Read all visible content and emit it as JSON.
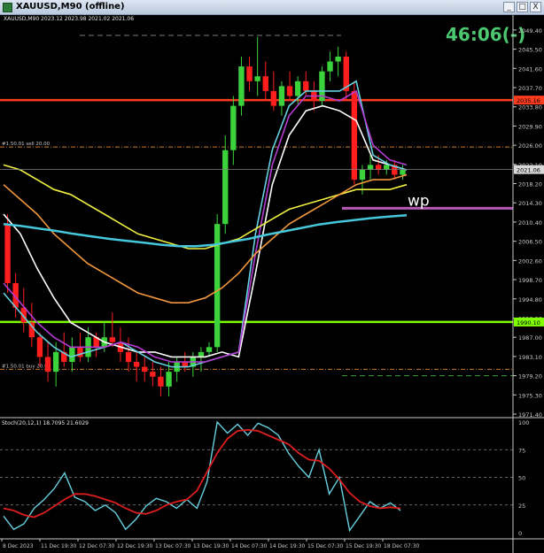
{
  "window": {
    "title": "XAUUSD,M90 (offline)",
    "buttons": [
      "_",
      "□",
      "X"
    ]
  },
  "chart_data": [
    {
      "type": "candlestick",
      "header": "XAUUSD,M90  2023.12 2023.98 2021.02 2021.06",
      "countdown": "46:06(-)",
      "ylim": [
        1971.4,
        2051.0
      ],
      "y_ticks": [
        "2049.40",
        "2045.50",
        "2041.60",
        "2037.70",
        "2033.80",
        "2029.90",
        "2026.00",
        "2022.10",
        "2018.20",
        "2014.30",
        "2010.40",
        "2006.50",
        "2002.60",
        "1998.70",
        "1994.80",
        "1990.90",
        "1987.00",
        "1983.10",
        "1979.20",
        "1975.30",
        "1971.40"
      ],
      "current_price": "2021.06",
      "hlines": [
        {
          "price": 2035.16,
          "label": "2035.16",
          "color": "#ff3c1e",
          "style": "solid"
        },
        {
          "price": 1990.1,
          "label": "1990.10",
          "color": "#7fff00",
          "style": "solid"
        },
        {
          "price": 2025.65,
          "color": "#d07a2c",
          "style": "dashdot",
          "label": "#1.50.01 sell 20.00"
        },
        {
          "price": 1980.5,
          "color": "#d07a2c",
          "style": "dashdot",
          "label": "#1.50.01 buy 20.00"
        },
        {
          "price": 1979.2,
          "color": "#3c9a3c",
          "style": "dash"
        }
      ],
      "annotation": {
        "text": "wp",
        "price": 2013.2,
        "color": "#b45ab4"
      },
      "candles": [
        [
          2010,
          2012,
          1996,
          1998
        ],
        [
          1998,
          2000,
          1991,
          1993
        ],
        [
          1993,
          1997,
          1988,
          1990
        ],
        [
          1990,
          1994,
          1985,
          1987
        ],
        [
          1987,
          1988,
          1981,
          1983
        ],
        [
          1983,
          1986,
          1978,
          1980
        ],
        [
          1980,
          1986,
          1977,
          1984
        ],
        [
          1984,
          1988,
          1981,
          1982
        ],
        [
          1982,
          1987,
          1980,
          1985
        ],
        [
          1985,
          1988,
          1982,
          1983
        ],
        [
          1983,
          1989,
          1982,
          1987
        ],
        [
          1987,
          1988,
          1983,
          1985
        ],
        [
          1985,
          1990,
          1984,
          1987
        ],
        [
          1987,
          1992,
          1985,
          1986
        ],
        [
          1986,
          1989,
          1982,
          1984
        ],
        [
          1984,
          1987,
          1980,
          1982
        ],
        [
          1982,
          1984,
          1978,
          1981
        ],
        [
          1981,
          1983,
          1978,
          1980
        ],
        [
          1980,
          1982,
          1977,
          1979
        ],
        [
          1979,
          1981,
          1975,
          1977
        ],
        [
          1977,
          1982,
          1975,
          1980
        ],
        [
          1980,
          1983,
          1978,
          1982
        ],
        [
          1982,
          1984,
          1980,
          1981
        ],
        [
          1981,
          1984,
          1979,
          1983
        ],
        [
          1983,
          1985,
          1980,
          1984
        ],
        [
          1984,
          1986,
          1983,
          1985
        ],
        [
          1985,
          2012,
          1984,
          2010
        ],
        [
          2010,
          2028,
          2008,
          2025
        ],
        [
          2025,
          2036,
          2022,
          2034
        ],
        [
          2034,
          2044,
          2032,
          2042
        ],
        [
          2042,
          2044,
          2037,
          2039
        ],
        [
          2039,
          2048,
          2036,
          2040
        ],
        [
          2040,
          2043,
          2035,
          2037
        ],
        [
          2037,
          2041,
          2033,
          2034
        ],
        [
          2034,
          2039,
          2032,
          2038
        ],
        [
          2038,
          2041,
          2035,
          2036
        ],
        [
          2036,
          2040,
          2034,
          2039
        ],
        [
          2039,
          2041,
          2036,
          2037
        ],
        [
          2037,
          2039,
          2033,
          2035
        ],
        [
          2035,
          2042,
          2034,
          2041
        ],
        [
          2041,
          2045,
          2039,
          2043
        ],
        [
          2043,
          2046,
          2040,
          2044
        ],
        [
          2044,
          2045,
          2035,
          2037
        ],
        [
          2037,
          2039,
          2018,
          2019
        ],
        [
          2019,
          2022,
          2016,
          2021
        ],
        [
          2021,
          2024,
          2019,
          2022
        ],
        [
          2022,
          2024,
          2020,
          2021
        ],
        [
          2021,
          2023,
          2020,
          2022
        ],
        [
          2022,
          2023,
          2019,
          2020
        ],
        [
          2020,
          2022,
          2019,
          2021
        ]
      ],
      "x_ticks": [
        "8 Dec 2023",
        "11 Dec 19:30",
        "12 Dec 07:30",
        "12 Dec 19:30",
        "13 Dec 07:30",
        "13 Dec 19:30",
        "14 Dec 07:30",
        "14 Dec 19:30",
        "15 Dec 07:30",
        "15 Dec 19:30",
        "18 Dec 07:30"
      ],
      "moving_averages": [
        {
          "color": "#ffffff",
          "points": [
            2012,
            2008,
            2001,
            1995,
            1990,
            1988,
            1986,
            1985,
            1984,
            1984,
            1983,
            1983,
            1983,
            1984,
            1983,
            2000,
            2018,
            2028,
            2033,
            2034,
            2033,
            2031,
            2023,
            2022,
            2021
          ]
        },
        {
          "color": "#66d0e0",
          "points": [
            1996,
            1992,
            1988,
            1985,
            1983,
            1984,
            1985,
            1986,
            1984,
            1982,
            1981,
            1981,
            1982,
            1983,
            1984,
            2008,
            2025,
            2034,
            2037,
            2037,
            2037,
            2039,
            2024,
            2022,
            2021
          ]
        },
        {
          "color": "#b43cd2",
          "points": [
            1998,
            1994,
            1990,
            1987,
            1985,
            1985,
            1985,
            1986,
            1985,
            1983,
            1982,
            1982,
            1982,
            1983,
            1984,
            2004,
            2022,
            2032,
            2036,
            2036,
            2035,
            2037,
            2026,
            2023,
            2022
          ]
        },
        {
          "color": "#f0f040",
          "points": [
            2022,
            2021,
            2019,
            2017,
            2016,
            2014,
            2012,
            2010,
            2008,
            2007,
            2006,
            2005,
            2005,
            2006,
            2007,
            2009,
            2011,
            2013,
            2014,
            2015,
            2016,
            2017,
            2017,
            2017,
            2018
          ]
        },
        {
          "color": "#f0963c",
          "points": [
            2018,
            2015,
            2012,
            2008,
            2005,
            2002,
            2000,
            1998,
            1996,
            1995,
            1994,
            1994,
            1995,
            1997,
            2000,
            2004,
            2007,
            2010,
            2012,
            2014,
            2016,
            2018,
            2019,
            2019,
            2020
          ]
        },
        {
          "color": "#46c8dc",
          "points": [
            2010,
            2009.6,
            2009.1,
            2008.6,
            2008.0,
            2007.5,
            2007.0,
            2006.6,
            2006.2,
            2005.8,
            2005.5,
            2005.5,
            2005.8,
            2006.4,
            2007.0,
            2007.8,
            2008.5,
            2009.2,
            2009.9,
            2010.4,
            2010.8,
            2011.2,
            2011.5,
            2011.8
          ]
        }
      ]
    },
    {
      "type": "line",
      "title": "Stoch(20,12,1) 18.7095 21.6029",
      "ylim": [
        0,
        100
      ],
      "y_ticks": [
        "100",
        "75",
        "50",
        "25",
        "0"
      ],
      "series": [
        {
          "color": "#66d0e0",
          "values": [
            15,
            3,
            8,
            22,
            30,
            40,
            54,
            32,
            28,
            20,
            25,
            18,
            3,
            12,
            24,
            31,
            28,
            22,
            30,
            22,
            46,
            100,
            90,
            98,
            88,
            99,
            95,
            88,
            72,
            60,
            50,
            75,
            35,
            50,
            2,
            15,
            28,
            22,
            27,
            20
          ]
        },
        {
          "color": "#dc1e1e",
          "values": [
            22,
            20,
            16,
            14,
            18,
            24,
            30,
            35,
            35,
            33,
            30,
            27,
            22,
            18,
            17,
            20,
            25,
            28,
            30,
            38,
            55,
            72,
            85,
            92,
            93,
            92,
            88,
            84,
            80,
            72,
            66,
            65,
            58,
            48,
            36,
            28,
            24,
            22,
            23,
            22
          ]
        }
      ]
    }
  ]
}
